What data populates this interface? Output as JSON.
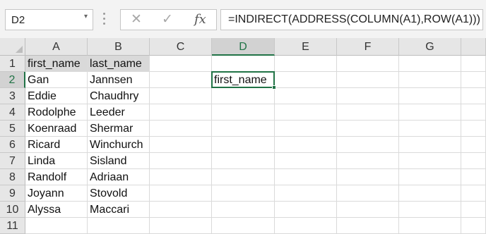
{
  "formula_bar": {
    "name_box": "D2",
    "name_box_arrow": "▾",
    "cancel_icon": "✕",
    "enter_icon": "✓",
    "fx_label": "fx",
    "formula": "=INDIRECT(ADDRESS(COLUMN(A1),ROW(A1)))"
  },
  "columns": [
    "A",
    "B",
    "C",
    "D",
    "E",
    "F",
    "G"
  ],
  "selected_column": "D",
  "rows": [
    "1",
    "2",
    "3",
    "4",
    "5",
    "6",
    "7",
    "8",
    "9",
    "10",
    "11"
  ],
  "selected_row": "2",
  "cells": {
    "A1": "first_name",
    "B1": "last_name",
    "A2": "Gan",
    "B2": "Jannsen",
    "D2": "first_name",
    "A3": "Eddie",
    "B3": "Chaudhry",
    "A4": "Rodolphe",
    "B4": "Leeder",
    "A5": "Koenraad",
    "B5": "Shermar",
    "A6": "Ricard",
    "B6": "Winchurch",
    "A7": "Linda",
    "B7": "Sisland",
    "A8": "Randolf",
    "B8": "Adriaan",
    "A9": "Joyann",
    "B9": "Stovold",
    "A10": "Alyssa",
    "B10": "Maccari"
  },
  "header_fill_color": "#d9d9d9",
  "accent_color": "#217346"
}
